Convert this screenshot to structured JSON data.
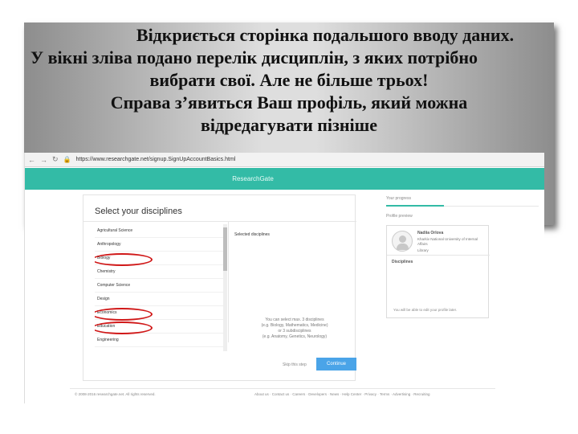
{
  "slide": {
    "lines": [
      "Відкриється сторінка подальшого вводу даних.",
      "У вікні зліва подано перелік дисциплін, з яких потрібно",
      "вибрати свої. Але не більше трьох!",
      "Справа з’явиться Ваш профіль, який можна",
      "відредагувати пізніше"
    ]
  },
  "browser": {
    "url": "https://www.researchgate.net/signup.SignUpAccountBasics.html",
    "brand": "ResearchGate"
  },
  "disciplines": {
    "title": "Select your disciplines",
    "items": [
      "Agricultural Science",
      "Anthropology",
      "Biology",
      "Chemistry",
      "Computer Science",
      "Design",
      "Economics",
      "Education",
      "Engineering"
    ],
    "highlighted": [
      "Biology",
      "Economics",
      "Education"
    ],
    "selected_title": "Selected disciplines",
    "hint_lines": [
      "You can select max. 3 disciplines",
      "(e.g. Biology, Mathematics, Medicine)",
      "or 3 subdisciplines",
      "(e.g. Anatomy, Genetics, Neurology)"
    ],
    "skip_label": "Skip this step",
    "continue_label": "Continue"
  },
  "sidebar": {
    "progress_label": "Your progress",
    "progress_fraction": 0.38,
    "preview_label": "Profile preview",
    "name": "Nadiia Orlova",
    "institution": "Kharkiv National University of Internal Affairs",
    "department": "Library",
    "disciplines_label": "Disciplines",
    "note": "You will be able to edit your profile later."
  },
  "footer": {
    "copyright": "© 2008-2016 researchgate.net. All rights reserved.",
    "links": "About us · Contact us · Careers · Developers · News · Help Center · Privacy · Terms · Advertising · Recruiting"
  },
  "colors": {
    "brand": "#33bba6",
    "button": "#4aa4e8",
    "highlight": "#d01818"
  }
}
